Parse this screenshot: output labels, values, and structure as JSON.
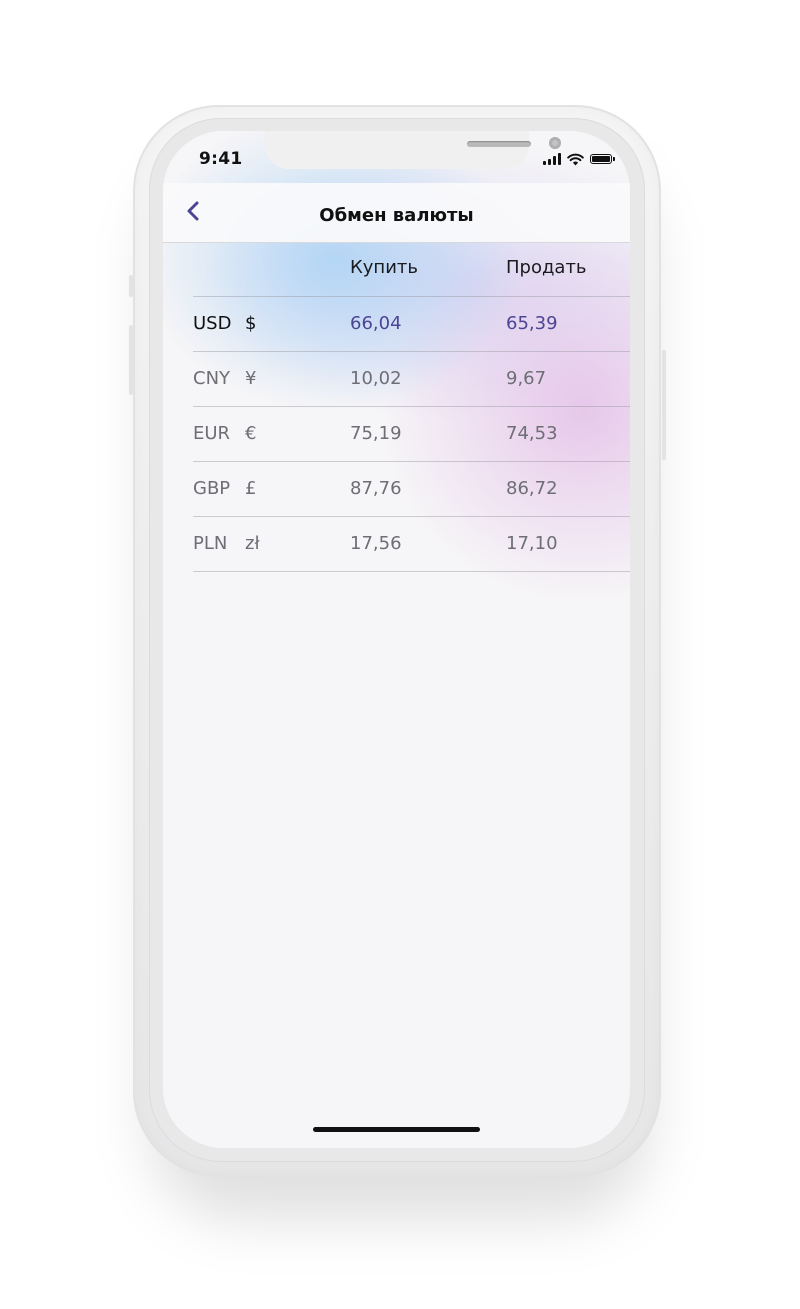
{
  "status_bar": {
    "time": "9:41",
    "icons": [
      "cellular-signal-icon",
      "wifi-icon",
      "battery-icon"
    ]
  },
  "navbar": {
    "back_icon": "chevron-left-icon",
    "title": "Обмен валюты"
  },
  "table": {
    "columns": {
      "buy": "Купить",
      "sell": "Продать"
    },
    "rows": [
      {
        "code": "USD",
        "symbol": "$",
        "buy": "66,04",
        "sell": "65,39"
      },
      {
        "code": "CNY",
        "symbol": "¥",
        "buy": "10,02",
        "sell": "9,67"
      },
      {
        "code": "EUR",
        "symbol": "€",
        "buy": "75,19",
        "sell": "74,53"
      },
      {
        "code": "GBP",
        "symbol": "£",
        "buy": "87,76",
        "sell": "86,72"
      },
      {
        "code": "PLN",
        "symbol": "zł",
        "buy": "17,56",
        "sell": "17,10"
      }
    ]
  },
  "colors": {
    "accent": "#4b4593",
    "text_primary": "#111111",
    "text_secondary": "#6e6e76",
    "background": "#f6f5f7"
  }
}
